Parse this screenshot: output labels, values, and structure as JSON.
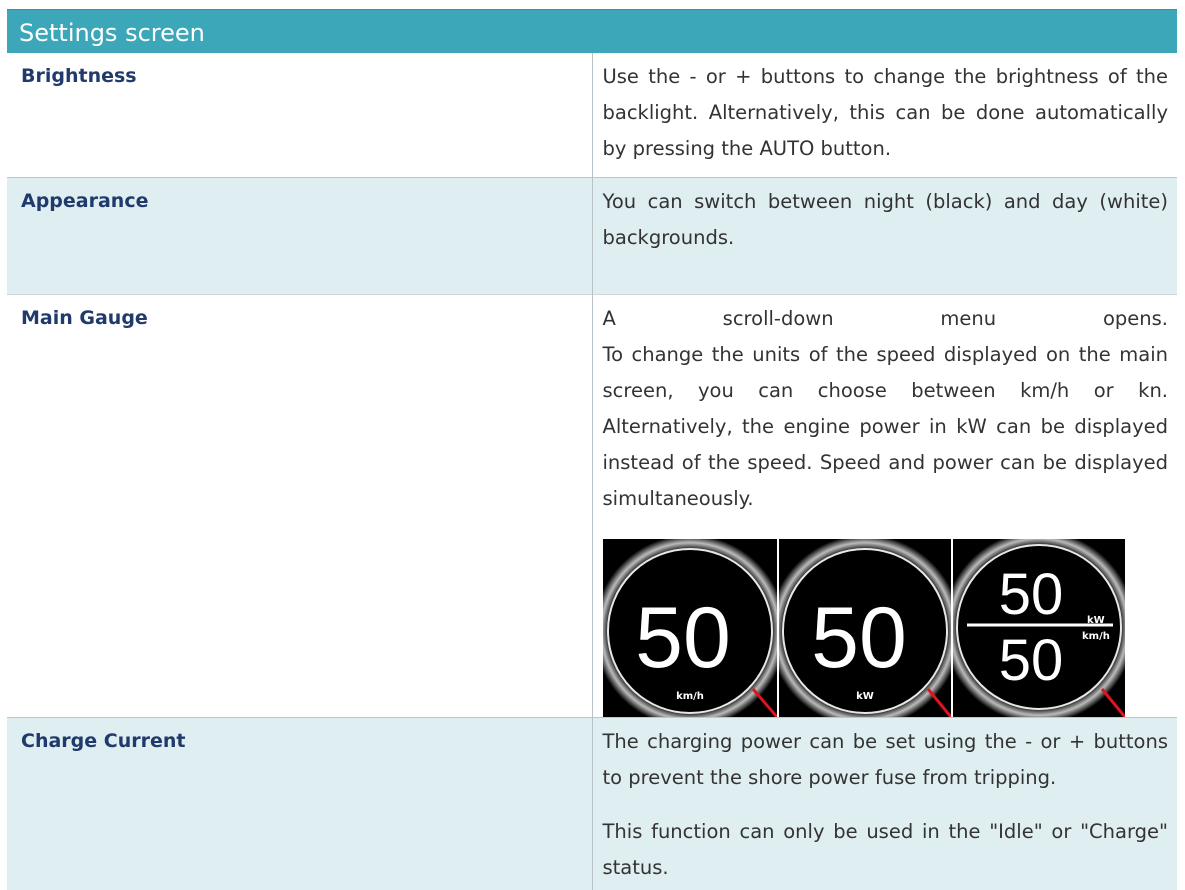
{
  "header": {
    "title": "Settings screen"
  },
  "rows": [
    {
      "label": "Brightness",
      "text": "Use the - or + buttons to change the brightness of the backlight. Alternatively, this can be done automatically by pressing the AUTO button."
    },
    {
      "label": "Appearance",
      "text": "You can switch between night (black) and day (white) backgrounds."
    },
    {
      "label": "Main Gauge",
      "line1": [
        "A",
        "scroll-down",
        "menu",
        "opens."
      ],
      "text": "To change the units of the speed displayed on the main screen, you can choose between km/h or kn. Alternatively, the engine power in kW can be displayed instead of the speed. Speed and power can be displayed simultaneously.",
      "gauges": [
        {
          "value": "50",
          "unit": "km/h"
        },
        {
          "value": "50",
          "unit": "kW"
        },
        {
          "value_top": "50",
          "value_bottom": "50",
          "unit_top": "kW",
          "unit_bottom": "km/h"
        }
      ]
    },
    {
      "label": "Charge Current",
      "text": "The charging power can be set using the - or + buttons to prevent the shore power fuse from tripping.",
      "text2": "This function can only be used in the \"Idle\" or \"Charge\" status."
    }
  ],
  "colors": {
    "header_bg": "#3ba7b8",
    "label": "#1f3a6b",
    "shade": "#dfeef1",
    "needle": "#e0141e"
  }
}
